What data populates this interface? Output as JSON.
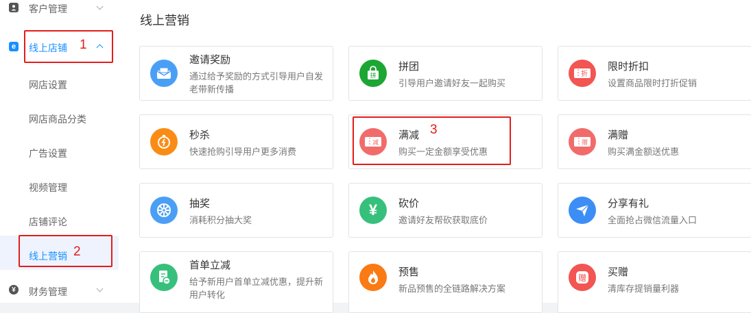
{
  "sidebar": {
    "customer": {
      "label": "客户管理",
      "icon": "user-icon"
    },
    "store": {
      "label": "线上店铺",
      "icon": "store-e-icon",
      "annotation": "1"
    },
    "sub_items": [
      {
        "label": "网店设置"
      },
      {
        "label": "网店商品分类"
      },
      {
        "label": "广告设置"
      },
      {
        "label": "视频管理"
      },
      {
        "label": "店铺评论"
      },
      {
        "label": "线上营销",
        "annotation": "2"
      }
    ],
    "finance": {
      "label": "财务管理",
      "icon": "yen-icon"
    }
  },
  "main": {
    "title": "线上营销",
    "cards": [
      {
        "title": "邀请奖励",
        "desc": "通过给予奖励的方式引导用户自发老带新传播",
        "icon": "envelope-icon",
        "color": "#4a9ff5"
      },
      {
        "title": "拼团",
        "desc": "引导用户邀请好友一起购买",
        "icon": "bag-icon",
        "glyph": "拼",
        "color": "#1ca633"
      },
      {
        "title": "限时折扣",
        "desc": "设置商品限时打折促销",
        "icon": "discount-ticket-icon",
        "glyph": "折",
        "color": "#f25552"
      },
      {
        "title": "秒杀",
        "desc": "快速抢购引导用户更多消费",
        "icon": "stopwatch-icon",
        "color": "#fa8c16"
      },
      {
        "title": "满减",
        "desc": "购买一定金额享受优惠",
        "icon": "coupon-icon",
        "glyph": "减",
        "color": "#f25552",
        "annotation": "3"
      },
      {
        "title": "满赠",
        "desc": "购买满金额送优惠",
        "icon": "coupon-icon",
        "glyph": "赠",
        "color": "#f25552"
      },
      {
        "title": "抽奖",
        "desc": "消耗积分抽大奖",
        "icon": "wheel-icon",
        "color": "#4a9ff5"
      },
      {
        "title": "砍价",
        "desc": "邀请好友帮砍获取底价",
        "icon": "yen-icon",
        "glyph": "¥",
        "color": "#37c07c"
      },
      {
        "title": "分享有礼",
        "desc": "全面抢占微信流量入口",
        "icon": "paper-plane-icon",
        "color": "#3c8ef5"
      },
      {
        "title": "首单立减",
        "desc": "给予新用户首单立减优惠，提升新用户转化",
        "icon": "document-minus-icon",
        "color": "#37c07c"
      },
      {
        "title": "预售",
        "desc": "新品预售的全链路解决方案",
        "icon": "flame-icon",
        "color": "#fa7a14"
      },
      {
        "title": "买赠",
        "desc": "清库存提销量利器",
        "icon": "gift-badge-icon",
        "glyph": "赠",
        "color": "#f25552"
      }
    ]
  }
}
